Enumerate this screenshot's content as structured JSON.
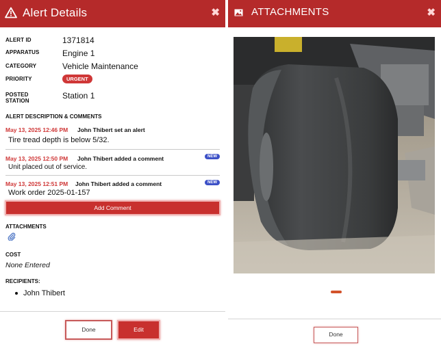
{
  "alert_panel": {
    "title": "Alert Details",
    "close_glyph": "✖",
    "header_icon": "warning-triangle-icon",
    "fields": {
      "alert_id": {
        "label": "ALERT ID",
        "value": "1371814"
      },
      "apparatus": {
        "label": "APPARATUS",
        "value": "Engine 1"
      },
      "category": {
        "label": "CATEGORY",
        "value": "Vehicle Maintenance"
      },
      "priority": {
        "label": "PRIORITY",
        "value": "URGENT"
      },
      "posted_station": {
        "label_line1": "POSTED",
        "label_line2": "STATION",
        "value": "Station 1"
      }
    },
    "comments_section_label": "ALERT DESCRIPTION & COMMENTS",
    "comments": [
      {
        "date": "May 13, 2025 12:46 PM",
        "author_action": "John Thibert set an alert",
        "text": "Tire tread depth is below 5/32.",
        "badge": ""
      },
      {
        "date": "May 13, 2025 12:50 PM",
        "author_action": "John Thibert added a comment",
        "text": "Unit placed out of service.",
        "badge": "NEW"
      },
      {
        "date": "May 13, 2025 12:51 PM",
        "author_action": "John Thibert added a comment",
        "text": "Work order 2025-01-157",
        "badge": "NEW"
      }
    ],
    "add_comment_label": "Add Comment",
    "attachments_label": "ATTACHMENTS",
    "attachment_icon": "paperclip-icon",
    "cost_label": "COST",
    "cost_value": "None Entered",
    "recipients_label": "RECIPIENTS:",
    "recipients": [
      "John Thibert"
    ],
    "done_label": "Done",
    "edit_label": "Edit"
  },
  "attachments_panel": {
    "title": "ATTACHMENTS",
    "header_icon": "image-icon",
    "close_glyph": "✖",
    "photo_subject": "truck tire",
    "done_label": "Done"
  },
  "colors": {
    "header_red": "#b52a2a",
    "accent_red": "#c8302e",
    "date_red": "#cf3737",
    "new_badge_blue": "#3d51c7",
    "clip_blue": "#5a7fc9"
  }
}
